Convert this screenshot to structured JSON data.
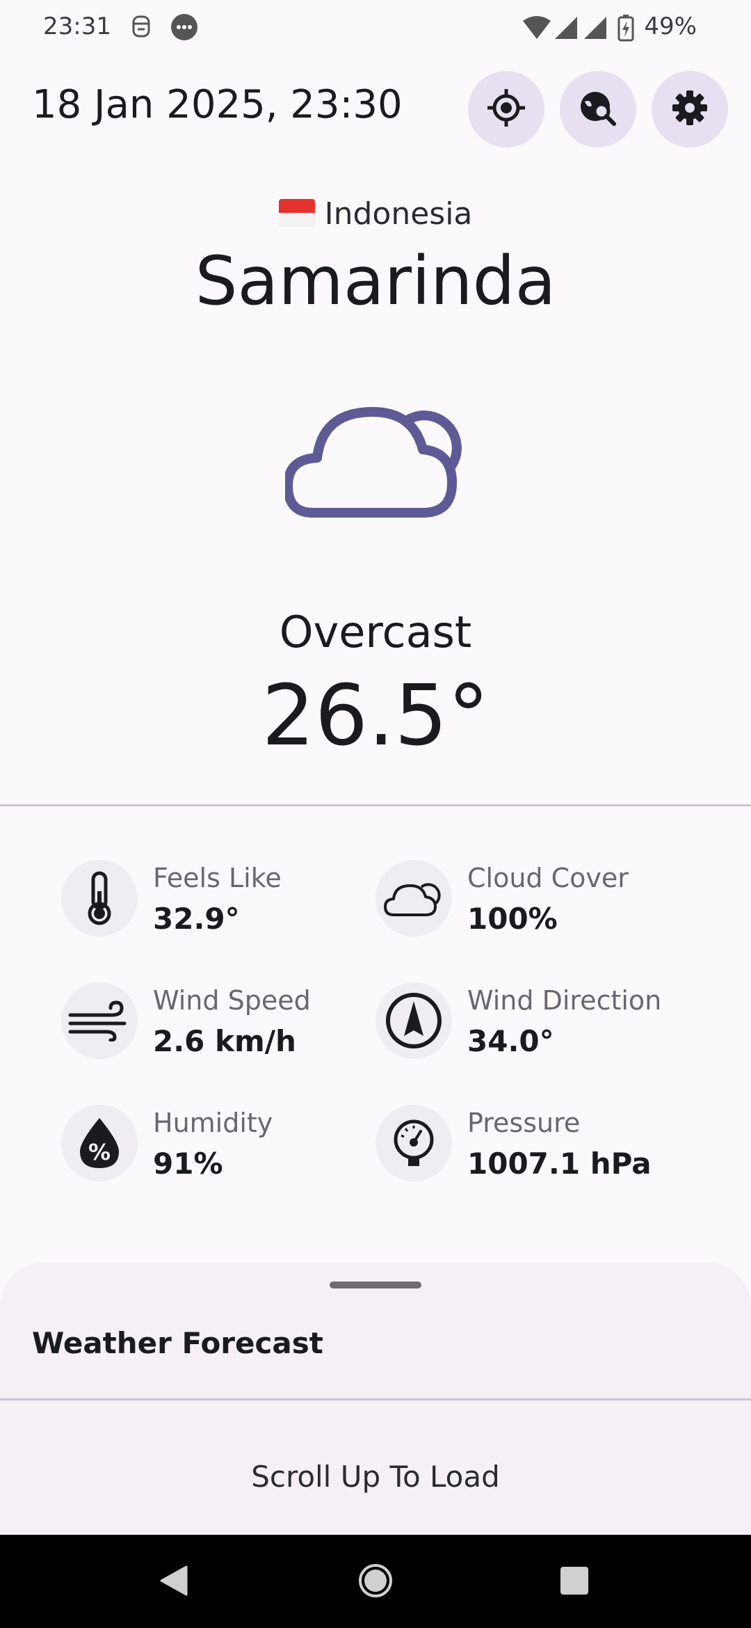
{
  "status_bar": {
    "time": "23:31",
    "battery": "49%",
    "icons": [
      "notification-app-icon",
      "chat-bubble-icon",
      "wifi-icon",
      "signal-icon",
      "signal-icon",
      "battery-charging-icon"
    ]
  },
  "header": {
    "datetime": "18 Jan 2025, 23:30",
    "buttons": [
      {
        "icon": "my-location-icon"
      },
      {
        "icon": "travel-explore-icon"
      },
      {
        "icon": "settings-gear-icon"
      }
    ]
  },
  "location": {
    "country": "Indonesia",
    "city": "Samarinda"
  },
  "current": {
    "icon": "cloud-icon",
    "condition": "Overcast",
    "temperature": "26.5°"
  },
  "details": [
    {
      "icon": "thermometer-icon",
      "label": "Feels Like",
      "value": "32.9°"
    },
    {
      "icon": "cloud-outline-icon",
      "label": "Cloud Cover",
      "value": "100%"
    },
    {
      "icon": "wind-icon",
      "label": "Wind Speed",
      "value": "2.6 km/h"
    },
    {
      "icon": "compass-arrow-icon",
      "label": "Wind Direction",
      "value": "34.0°"
    },
    {
      "icon": "humidity-drop-icon",
      "label": "Humidity",
      "value": "91%"
    },
    {
      "icon": "pressure-gauge-icon",
      "label": "Pressure",
      "value": "1007.1 hPa"
    }
  ],
  "forecast_sheet": {
    "title": "Weather Forecast",
    "hint": "Scroll Up To Load"
  },
  "colors": {
    "accent": "#5e5a95",
    "button_bg": "#e7e0f0",
    "background": "#fcf9fd"
  }
}
